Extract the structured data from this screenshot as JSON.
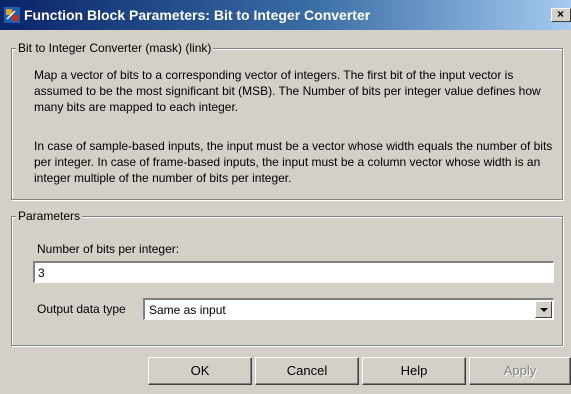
{
  "window": {
    "title": "Function Block Parameters: Bit to Integer Converter",
    "close_glyph": "×"
  },
  "description_group": {
    "legend": "Bit to Integer Converter (mask) (link)",
    "paragraph1": "Map a vector of bits to a corresponding vector of integers. The first bit of the input vector is assumed to be the most significant bit (MSB). The Number of bits per integer value defines how many bits are mapped to each integer.",
    "paragraph2": "In case of sample-based inputs, the input must be a vector whose width equals the number of bits per integer. In case of frame-based inputs, the input must be a column vector whose width is an integer multiple of the number of bits per integer."
  },
  "parameters_group": {
    "legend": "Parameters",
    "bits_label": "Number of bits per integer:",
    "bits_value": "3",
    "output_type_label": "Output data type",
    "output_type_value": "Same as input"
  },
  "buttons": {
    "ok": "OK",
    "cancel": "Cancel",
    "help": "Help",
    "apply": "Apply"
  }
}
